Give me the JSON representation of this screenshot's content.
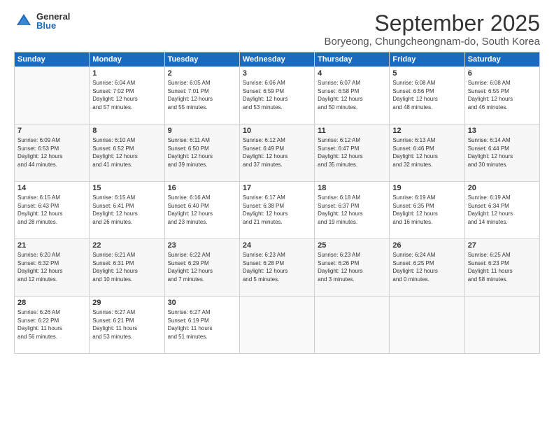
{
  "logo": {
    "general": "General",
    "blue": "Blue"
  },
  "title": "September 2025",
  "location": "Boryeong, Chungcheongnam-do, South Korea",
  "weekdays": [
    "Sunday",
    "Monday",
    "Tuesday",
    "Wednesday",
    "Thursday",
    "Friday",
    "Saturday"
  ],
  "weeks": [
    [
      {
        "day": "",
        "info": ""
      },
      {
        "day": "1",
        "info": "Sunrise: 6:04 AM\nSunset: 7:02 PM\nDaylight: 12 hours\nand 57 minutes."
      },
      {
        "day": "2",
        "info": "Sunrise: 6:05 AM\nSunset: 7:01 PM\nDaylight: 12 hours\nand 55 minutes."
      },
      {
        "day": "3",
        "info": "Sunrise: 6:06 AM\nSunset: 6:59 PM\nDaylight: 12 hours\nand 53 minutes."
      },
      {
        "day": "4",
        "info": "Sunrise: 6:07 AM\nSunset: 6:58 PM\nDaylight: 12 hours\nand 50 minutes."
      },
      {
        "day": "5",
        "info": "Sunrise: 6:08 AM\nSunset: 6:56 PM\nDaylight: 12 hours\nand 48 minutes."
      },
      {
        "day": "6",
        "info": "Sunrise: 6:08 AM\nSunset: 6:55 PM\nDaylight: 12 hours\nand 46 minutes."
      }
    ],
    [
      {
        "day": "7",
        "info": "Sunrise: 6:09 AM\nSunset: 6:53 PM\nDaylight: 12 hours\nand 44 minutes."
      },
      {
        "day": "8",
        "info": "Sunrise: 6:10 AM\nSunset: 6:52 PM\nDaylight: 12 hours\nand 41 minutes."
      },
      {
        "day": "9",
        "info": "Sunrise: 6:11 AM\nSunset: 6:50 PM\nDaylight: 12 hours\nand 39 minutes."
      },
      {
        "day": "10",
        "info": "Sunrise: 6:12 AM\nSunset: 6:49 PM\nDaylight: 12 hours\nand 37 minutes."
      },
      {
        "day": "11",
        "info": "Sunrise: 6:12 AM\nSunset: 6:47 PM\nDaylight: 12 hours\nand 35 minutes."
      },
      {
        "day": "12",
        "info": "Sunrise: 6:13 AM\nSunset: 6:46 PM\nDaylight: 12 hours\nand 32 minutes."
      },
      {
        "day": "13",
        "info": "Sunrise: 6:14 AM\nSunset: 6:44 PM\nDaylight: 12 hours\nand 30 minutes."
      }
    ],
    [
      {
        "day": "14",
        "info": "Sunrise: 6:15 AM\nSunset: 6:43 PM\nDaylight: 12 hours\nand 28 minutes."
      },
      {
        "day": "15",
        "info": "Sunrise: 6:15 AM\nSunset: 6:41 PM\nDaylight: 12 hours\nand 26 minutes."
      },
      {
        "day": "16",
        "info": "Sunrise: 6:16 AM\nSunset: 6:40 PM\nDaylight: 12 hours\nand 23 minutes."
      },
      {
        "day": "17",
        "info": "Sunrise: 6:17 AM\nSunset: 6:38 PM\nDaylight: 12 hours\nand 21 minutes."
      },
      {
        "day": "18",
        "info": "Sunrise: 6:18 AM\nSunset: 6:37 PM\nDaylight: 12 hours\nand 19 minutes."
      },
      {
        "day": "19",
        "info": "Sunrise: 6:19 AM\nSunset: 6:35 PM\nDaylight: 12 hours\nand 16 minutes."
      },
      {
        "day": "20",
        "info": "Sunrise: 6:19 AM\nSunset: 6:34 PM\nDaylight: 12 hours\nand 14 minutes."
      }
    ],
    [
      {
        "day": "21",
        "info": "Sunrise: 6:20 AM\nSunset: 6:32 PM\nDaylight: 12 hours\nand 12 minutes."
      },
      {
        "day": "22",
        "info": "Sunrise: 6:21 AM\nSunset: 6:31 PM\nDaylight: 12 hours\nand 10 minutes."
      },
      {
        "day": "23",
        "info": "Sunrise: 6:22 AM\nSunset: 6:29 PM\nDaylight: 12 hours\nand 7 minutes."
      },
      {
        "day": "24",
        "info": "Sunrise: 6:23 AM\nSunset: 6:28 PM\nDaylight: 12 hours\nand 5 minutes."
      },
      {
        "day": "25",
        "info": "Sunrise: 6:23 AM\nSunset: 6:26 PM\nDaylight: 12 hours\nand 3 minutes."
      },
      {
        "day": "26",
        "info": "Sunrise: 6:24 AM\nSunset: 6:25 PM\nDaylight: 12 hours\nand 0 minutes."
      },
      {
        "day": "27",
        "info": "Sunrise: 6:25 AM\nSunset: 6:23 PM\nDaylight: 11 hours\nand 58 minutes."
      }
    ],
    [
      {
        "day": "28",
        "info": "Sunrise: 6:26 AM\nSunset: 6:22 PM\nDaylight: 11 hours\nand 56 minutes."
      },
      {
        "day": "29",
        "info": "Sunrise: 6:27 AM\nSunset: 6:21 PM\nDaylight: 11 hours\nand 53 minutes."
      },
      {
        "day": "30",
        "info": "Sunrise: 6:27 AM\nSunset: 6:19 PM\nDaylight: 11 hours\nand 51 minutes."
      },
      {
        "day": "",
        "info": ""
      },
      {
        "day": "",
        "info": ""
      },
      {
        "day": "",
        "info": ""
      },
      {
        "day": "",
        "info": ""
      }
    ]
  ]
}
